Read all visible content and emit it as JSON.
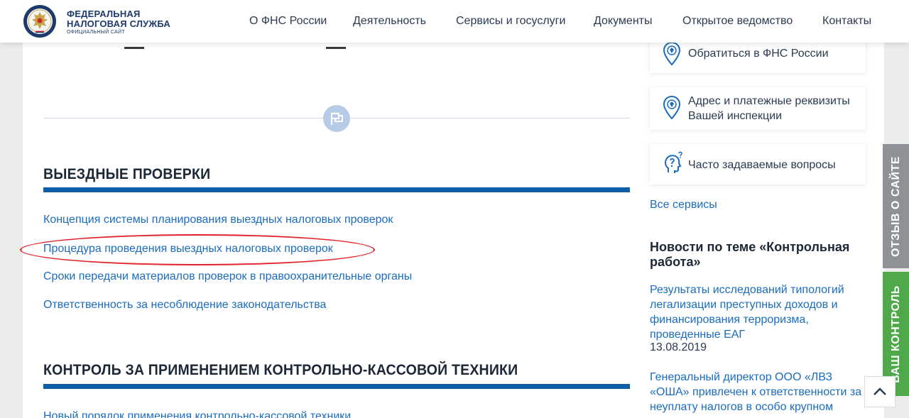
{
  "header": {
    "logo": {
      "line1": "ФЕДЕРАЛЬНАЯ",
      "line2": "НАЛОГОВАЯ СЛУЖБА",
      "sub": "ОФИЦИАЛЬНЫЙ САЙТ"
    },
    "nav": [
      {
        "label": "О ФНС России"
      },
      {
        "label": "Деятельность"
      },
      {
        "label": "Сервисы и госуслуги"
      },
      {
        "label": "Документы"
      },
      {
        "label": "Открытое ведомство"
      },
      {
        "label": "Контакты"
      }
    ]
  },
  "sections": [
    {
      "title": "ВЫЕЗДНЫЕ ПРОВЕРКИ",
      "links": [
        "Концепция системы планирования выездных налоговых проверок",
        "Процедура проведения выездных налоговых проверок",
        "Сроки передачи материалов проверок в правоохранительные органы",
        "Ответственность за несоблюдение законодательства"
      ]
    },
    {
      "title": "КОНТРОЛЬ ЗА ПРИМЕНЕНИЕМ КОНТРОЛЬНО-КАССОВОЙ ТЕХНИКИ",
      "links": [
        "Новый порядок применения контрольно-кассовой техники"
      ]
    }
  ],
  "sidebar": {
    "cards": [
      {
        "text": "Обратиться в ФНС России",
        "icon": "location-pin-icon"
      },
      {
        "text_line1": "Адрес и платежные реквизиты",
        "text_line2": "Вашей инспекции",
        "icon": "location-pin-icon"
      },
      {
        "text": "Часто задаваемые вопросы",
        "icon": "question-head-icon"
      }
    ],
    "all_services": "Все сервисы",
    "news_title": "Новости по теме «Контрольная работа»",
    "news": [
      {
        "text": "Результаты исследований типологий легализации преступных доходов и финансирования терроризма, проведенные ЕАГ",
        "date": "13.08.2019"
      },
      {
        "text": "Генеральный директор ООО «ЛВЗ «ОША» привлечен к ответственности за неуплату налогов в особо крупном"
      }
    ]
  },
  "side_tabs": [
    {
      "label": "ОТЗЫВ О САЙТЕ",
      "color": "#8e9196"
    },
    {
      "label": "ВАШ КОНТРОЛЬ",
      "color": "#4fa84a"
    }
  ],
  "colors": {
    "brand_blue": "#0d5ea6",
    "link": "#1a6cbf",
    "annotation": "#e2232a"
  }
}
